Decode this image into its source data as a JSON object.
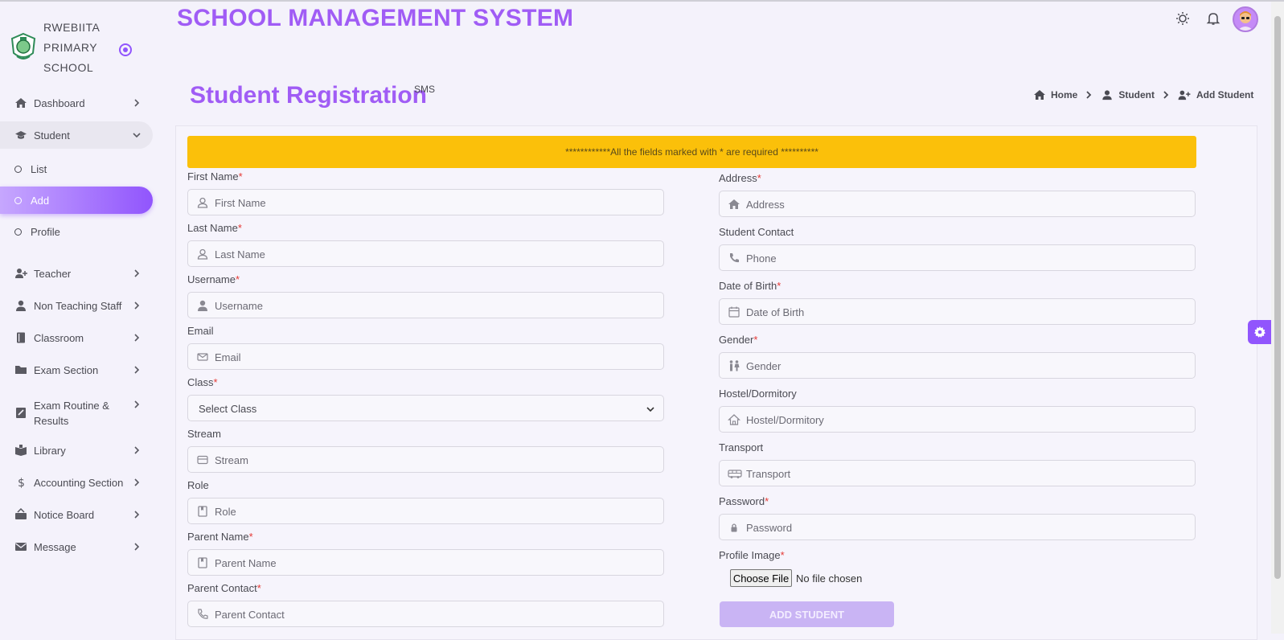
{
  "brand": {
    "line1": "RWEBIITA",
    "line2": "PRIMARY",
    "line3": "SCHOOL"
  },
  "header": {
    "app_title": "SCHOOL MANAGEMENT SYSTEM"
  },
  "sidebar": {
    "items": [
      {
        "label": "Dashboard"
      },
      {
        "label": "Student"
      },
      {
        "label": "Teacher"
      },
      {
        "label": "Non Teaching Staff"
      },
      {
        "label": "Classroom"
      },
      {
        "label": "Exam Section"
      },
      {
        "label": "Exam Routine &",
        "label2": "Results"
      },
      {
        "label": "Library"
      },
      {
        "label": "Accounting Section"
      },
      {
        "label": "Notice Board"
      },
      {
        "label": "Message"
      }
    ],
    "student_sub": [
      {
        "label": "List"
      },
      {
        "label": "Add"
      },
      {
        "label": "Profile"
      }
    ]
  },
  "page": {
    "title": "Student Registration",
    "sup": "SMS"
  },
  "breadcrumb": {
    "home": "Home",
    "student": "Student",
    "add": "Add Student"
  },
  "form": {
    "banner": "************All the fields marked with * are required **********",
    "left": [
      {
        "label": "First Name",
        "req": "*",
        "placeholder": "First Name"
      },
      {
        "label": "Last Name",
        "req": "*",
        "placeholder": "Last Name"
      },
      {
        "label": "Username",
        "req": "*",
        "placeholder": "Username"
      },
      {
        "label": "Email",
        "req": "",
        "placeholder": "Email"
      },
      {
        "label": "Class",
        "req": "*",
        "placeholder": "Select Class"
      },
      {
        "label": "Stream",
        "req": "",
        "placeholder": "Stream"
      },
      {
        "label": "Role",
        "req": "",
        "placeholder": "Role"
      },
      {
        "label": "Parent Name",
        "req": "*",
        "placeholder": "Parent Name"
      },
      {
        "label": "Parent Contact",
        "req": "*",
        "placeholder": "Parent Contact"
      }
    ],
    "right": [
      {
        "label": "Address",
        "req": "*",
        "placeholder": "Address"
      },
      {
        "label": "Student Contact",
        "req": "",
        "placeholder": "Phone"
      },
      {
        "label": "Date of Birth",
        "req": "*",
        "placeholder": "Date of Birth"
      },
      {
        "label": "Gender",
        "req": "*",
        "placeholder": "Gender"
      },
      {
        "label": "Hostel/Dormitory",
        "req": "",
        "placeholder": "Hostel/Dormitory"
      },
      {
        "label": "Transport",
        "req": "",
        "placeholder": "Transport"
      },
      {
        "label": "Password",
        "req": "*",
        "placeholder": "Password"
      },
      {
        "label": "Profile Image",
        "req": "*"
      }
    ],
    "file_button": "Choose File",
    "file_status": "No file chosen",
    "submit": "ADD STUDENT"
  },
  "colors": {
    "accent": "#9155fd",
    "title": "#a05cf5",
    "banner": "#fbc00a",
    "required": "#e53935"
  }
}
